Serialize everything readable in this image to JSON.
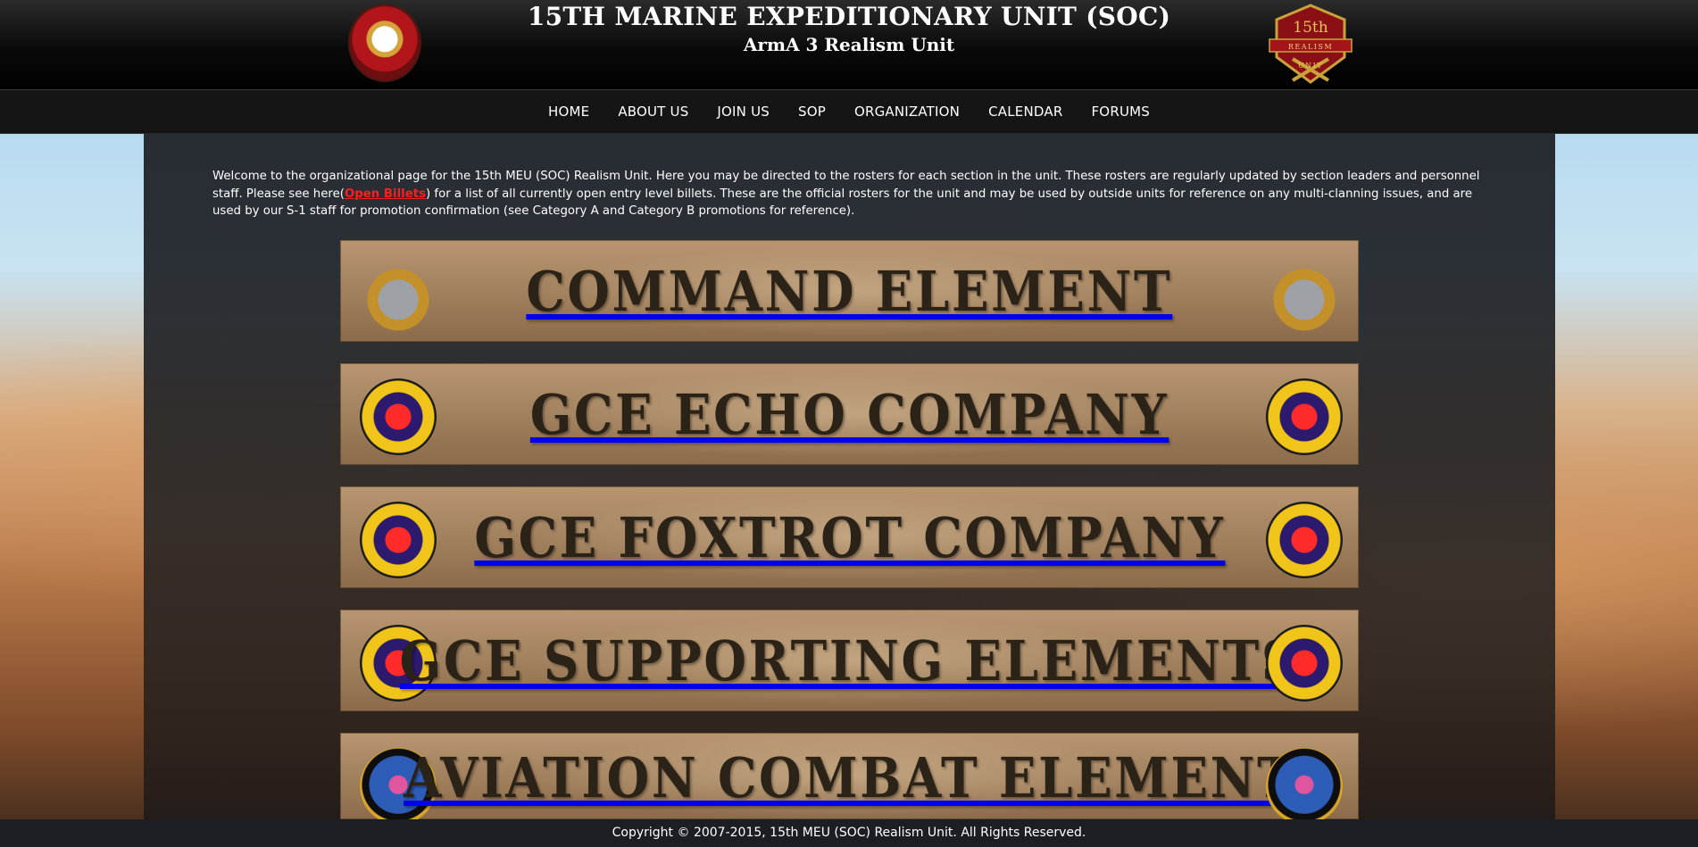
{
  "header": {
    "title": "15TH MARINE EXPEDITIONARY UNIT (SOC)",
    "subtitle": "ArmA 3 Realism Unit",
    "right_logo": {
      "top_text": "15th",
      "mid_text": "REALISM",
      "bottom_text": "UNIT"
    }
  },
  "nav": {
    "items": [
      "HOME",
      "ABOUT US",
      "JOIN US",
      "SOP",
      "ORGANIZATION",
      "CALENDAR",
      "FORUMS"
    ]
  },
  "intro": {
    "before": "Welcome to the organizational page for the 15th MEU (SOC) Realism Unit. Here you may be directed to the rosters for each section in the unit. These rosters are regularly updated by section leaders and personnel staff. Please see here(",
    "link": "Open Billets",
    "after": ") for a list of all currently open entry level billets. These are the official rosters for the unit and may be used by outside units for reference on any multi-clanning issues, and are used by our S-1 staff for promotion confirmation (see Category A and Category B promotions for reference)."
  },
  "banners": [
    {
      "label": "COMMAND ELEMENT",
      "icon": "usmc-emblem-icon"
    },
    {
      "label": "GCE ECHO COMPANY",
      "icon": "battalion-crest-icon"
    },
    {
      "label": "GCE FOXTROT COMPANY",
      "icon": "battalion-crest-icon"
    },
    {
      "label": "GCE SUPPORTING ELEMENTS",
      "icon": "battalion-crest-icon"
    },
    {
      "label": "AVIATION COMBAT ELEMENT",
      "icon": "squadron-dragon-icon"
    }
  ],
  "footer": {
    "text": "Copyright © 2007-2015, 15th MEU (SOC) Realism Unit. All Rights Reserved."
  }
}
